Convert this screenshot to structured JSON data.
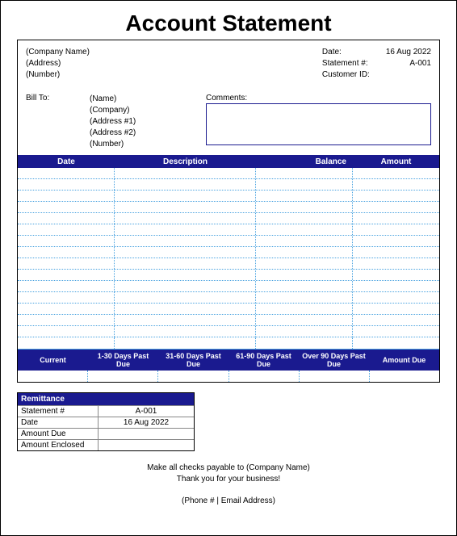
{
  "title": "Account Statement",
  "company": {
    "name": "(Company Name)",
    "address": "(Address)",
    "number": "(Number)"
  },
  "meta": {
    "date_label": "Date:",
    "date_value": "16 Aug 2022",
    "statement_label": "Statement #:",
    "statement_value": "A-001",
    "customer_label": "Customer ID:",
    "customer_value": ""
  },
  "billto": {
    "label": "Bill To:",
    "name": "(Name)",
    "company": "(Company)",
    "address1": "(Address #1)",
    "address2": "(Address #2)",
    "number": "(Number)"
  },
  "comments_label": "Comments:",
  "ledger": {
    "headers": {
      "date": "Date",
      "description": "Description",
      "balance": "Balance",
      "amount": "Amount"
    },
    "row_count": 16
  },
  "aging": {
    "current": "Current",
    "b1": "1-30 Days Past Due",
    "b2": "31-60 Days Past Due",
    "b3": "61-90 Days Past Due",
    "b4": "Over 90 Days Past Due",
    "due": "Amount Due"
  },
  "remittance": {
    "header": "Remittance",
    "statement_label": "Statement #",
    "statement_value": "A-001",
    "date_label": "Date",
    "date_value": "16 Aug 2022",
    "amount_due_label": "Amount Due",
    "amount_due_value": "",
    "enclosed_label": "Amount Enclosed",
    "enclosed_value": ""
  },
  "footer": {
    "payable": "Make all checks payable to (Company Name)",
    "thanks": "Thank you for your business!",
    "contact": "(Phone # | Email Address)"
  }
}
